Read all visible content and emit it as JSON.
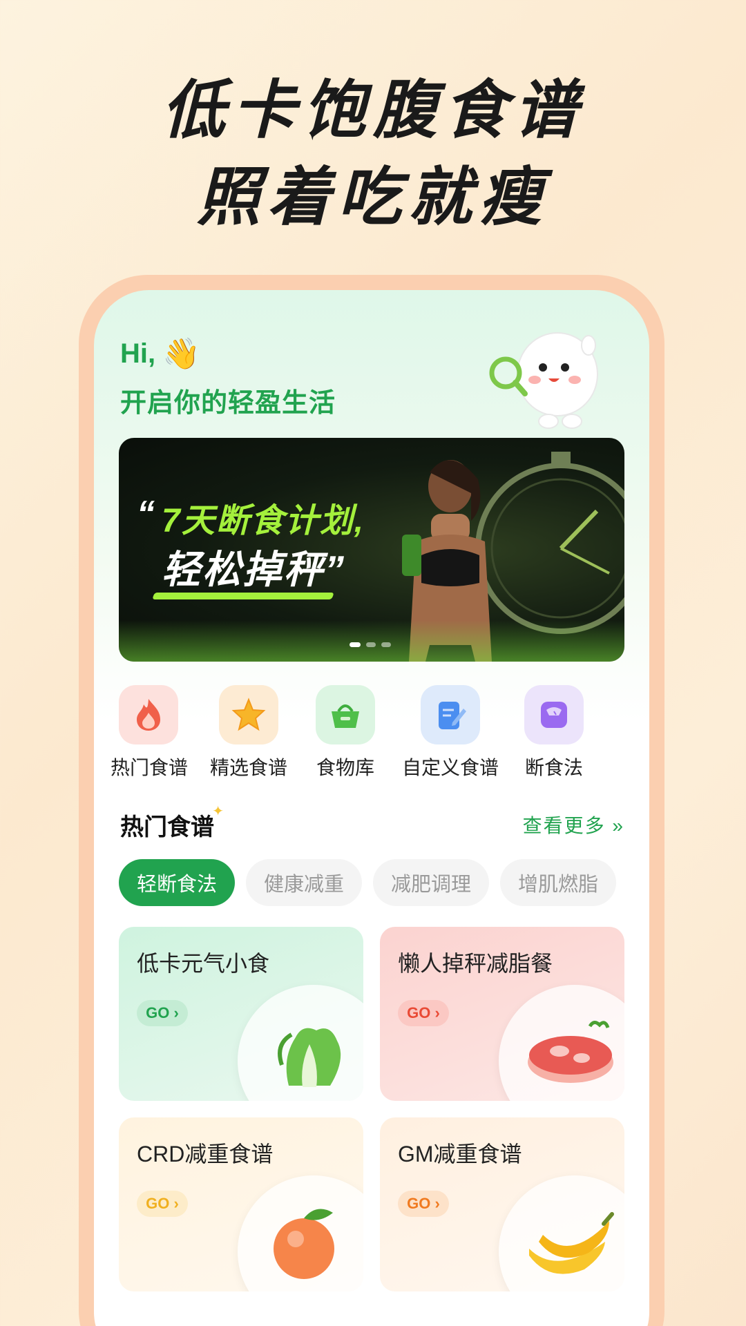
{
  "headline": {
    "line1": "低卡饱腹食谱",
    "line2": "照着吃就瘦"
  },
  "greeting": {
    "hi": "Hi,",
    "subtitle": "开启你的轻盈生活"
  },
  "banner": {
    "quote_open": "“",
    "title1": "7天断食计划,",
    "title2": "轻松掉秤”",
    "slide_count": 3,
    "active_slide": 1
  },
  "categories": [
    {
      "label": "热门食谱",
      "icon": "flame-icon",
      "color": "#fde1dd"
    },
    {
      "label": "精选食谱",
      "icon": "star-icon",
      "color": "#fdebd3"
    },
    {
      "label": "食物库",
      "icon": "basket-icon",
      "color": "#dcf5e2"
    },
    {
      "label": "自定义食谱",
      "icon": "notebook-pen-icon",
      "color": "#deeafb"
    },
    {
      "label": "断食法",
      "icon": "scale-icon",
      "color": "#ece4fb"
    }
  ],
  "section": {
    "title": "热门食谱",
    "more": "查看更多 »"
  },
  "tabs": [
    "轻断食法",
    "健康减重",
    "减肥调理",
    "增肌燃脂"
  ],
  "cards": [
    {
      "title": "低卡元气小食",
      "go": "GO ›",
      "icon": "bok-choy-icon"
    },
    {
      "title": "懒人掉秤减脂餐",
      "go": "GO ›",
      "icon": "steak-icon"
    },
    {
      "title": "CRD减重食谱",
      "go": "GO ›",
      "icon": "orange-icon"
    },
    {
      "title": "GM减重食谱",
      "go": "GO ›",
      "icon": "banana-icon"
    }
  ],
  "colors": {
    "accent": "#21a34f",
    "headline": "#1a1a1a",
    "banner_accent": "#a4f03c"
  }
}
